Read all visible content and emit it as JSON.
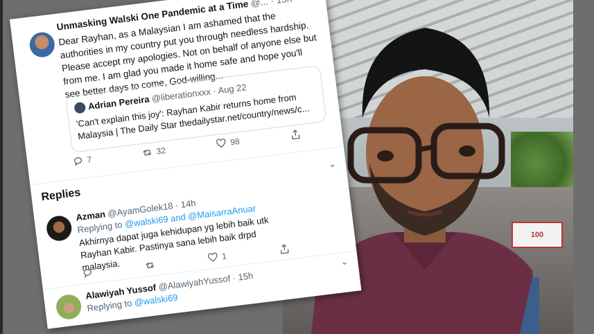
{
  "main_tweet": {
    "name": "Unmasking Walski One Pandemic at a Time",
    "handle": "@...",
    "time": "· 15h",
    "body": "Dear Rayhan, as a Malaysian I am ashamed that the authorities in my country put you through needless hardship. Please accept my apologies. Not on behalf of anyone else but from me. I am glad you made it home safe and hope you'll see better days to come, God-willing...",
    "quote": {
      "name": "Adrian Pereira",
      "handle": "@liberationxxx",
      "time": "· Aug 22",
      "body": "'Can't explain this joy': Rayhan Kabir returns home from Malaysia | The Daily Star thedailystar.net/country/news/c..."
    },
    "reply_count": "7",
    "retweet_count": "32",
    "like_count": "98"
  },
  "replies_title": "Replies",
  "replies": [
    {
      "name": "Azman",
      "handle": "@AyamGolek18 · 14h",
      "replying_to": "Replying to",
      "mention1": "@walski69",
      "and": "and",
      "mention2": "@MaisarraAnuar",
      "body": "Akhirnya dapat juga kehidupan yg lebih baik utk Rayhan Kabir. Pastinya sana lebih baik drpd malaysia.",
      "like_count": "1"
    },
    {
      "name": "Alawiyah Yussof",
      "handle": "@AlawiyahYussof · 15h",
      "replying_to": "Replying to",
      "mention1": "@walski69"
    }
  ],
  "photo": {
    "sign_text": "100"
  },
  "colors": {
    "accent": "#1d9bf0",
    "text": "#0f1419",
    "muted": "#536471"
  }
}
